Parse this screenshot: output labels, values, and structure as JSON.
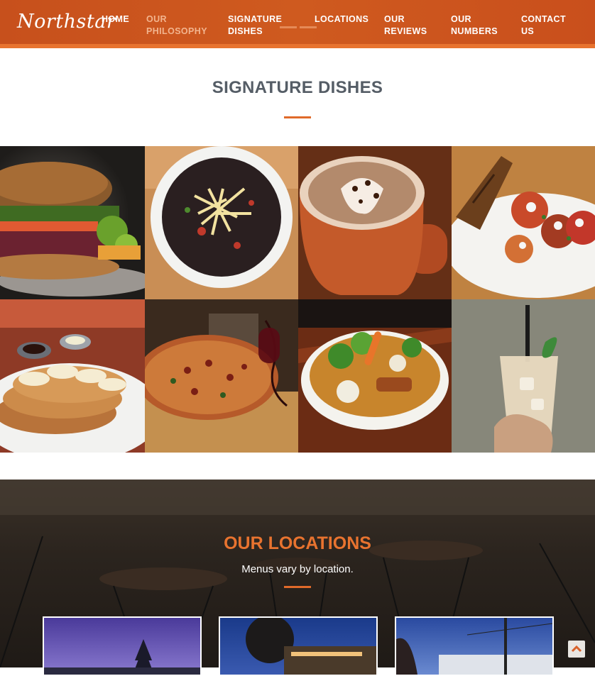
{
  "brand": {
    "logo": "Northstar",
    "accent": "#e8732f",
    "nav_color": "#cb541e"
  },
  "nav": {
    "items": [
      {
        "label": "HOME",
        "active": false
      },
      {
        "label": "OUR\nPHILOSOPHY",
        "active": true
      },
      {
        "label": "SIGNATURE\nDISHES",
        "active": false
      },
      {
        "label": "LOCATIONS",
        "active": false
      },
      {
        "label": "OUR\nREVIEWS",
        "active": false
      },
      {
        "label": "OUR\nNUMBERS",
        "active": false
      },
      {
        "label": "CONTACT\nUS",
        "active": false
      }
    ]
  },
  "signature": {
    "title": "SIGNATURE DISHES",
    "dishes": [
      {
        "name": "burger",
        "icon": "burger-photo"
      },
      {
        "name": "black bean bowl",
        "icon": "bean-bowl-photo"
      },
      {
        "name": "hot chocolate",
        "icon": "hot-chocolate-photo"
      },
      {
        "name": "tomato salad with toast",
        "icon": "tomato-salad-photo"
      },
      {
        "name": "pancakes with bananas",
        "icon": "pancakes-photo"
      },
      {
        "name": "pizza",
        "icon": "pizza-photo"
      },
      {
        "name": "vegetable curry bowl",
        "icon": "veggie-bowl-photo"
      },
      {
        "name": "iced coffee",
        "icon": "iced-coffee-photo"
      }
    ]
  },
  "locations": {
    "title": "OUR LOCATIONS",
    "subtitle": "Menus vary by location."
  },
  "scroll_top": {
    "icon": "chevron-up-icon"
  }
}
